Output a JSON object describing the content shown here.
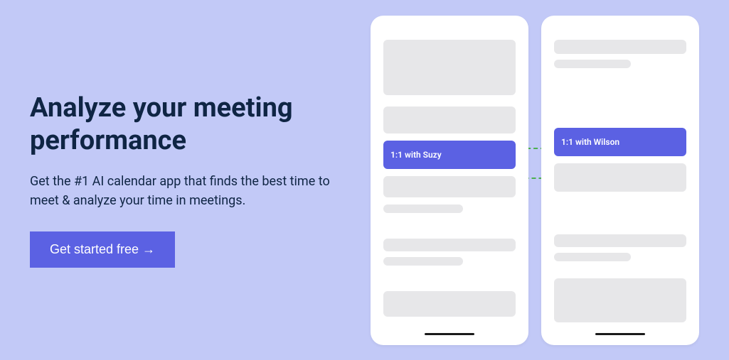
{
  "hero": {
    "heading": "Analyze your meeting performance",
    "subtext": "Get the #1 AI calendar app that finds the best time to meet & analyze your time in meetings.",
    "cta_label": "Get started free →"
  },
  "phones": {
    "meeting1": "1:1 with Suzy",
    "meeting2": "1:1 with Wilson"
  }
}
